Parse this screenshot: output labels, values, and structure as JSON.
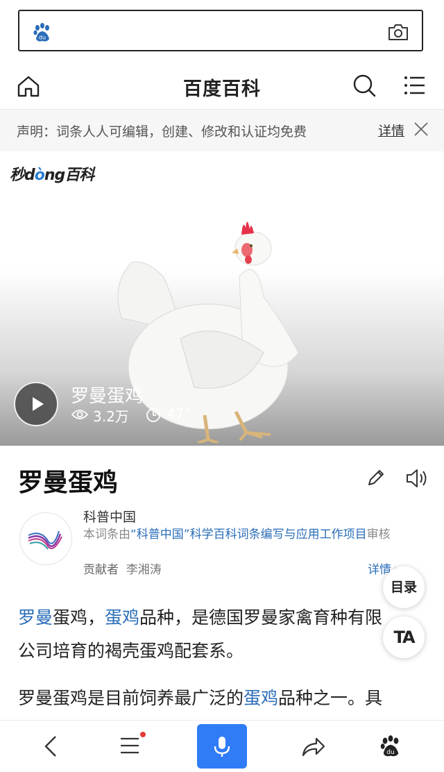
{
  "search": {
    "icon_left": "baidu-paw-icon",
    "icon_right": "camera-icon"
  },
  "header": {
    "title": "百度百科",
    "icons": [
      "home-icon",
      "search-icon",
      "menu-icon"
    ]
  },
  "notice": {
    "text": "声明：词条人人可编辑，创建、修改和认证均免费",
    "detail_label": "详情"
  },
  "video": {
    "logo_pre": "秒d",
    "logo_o": "ò",
    "logo_post": "ng百科",
    "title": "罗曼蛋鸡",
    "views": "3.2万",
    "duration": "47\""
  },
  "entry": {
    "title": "罗曼蛋鸡"
  },
  "certification": {
    "name": "科普中国",
    "desc_pre": "本词条由",
    "desc_link": "“科普中国”科学百科词条编写与应用工作项目",
    "desc_post": "审核",
    "contributor_label": "贡献者",
    "contributor_name": "李湘涛",
    "more_label": "详情 ▸"
  },
  "floating": {
    "toc_label": "目录",
    "text_size_label": "TA"
  },
  "content": {
    "p1_link1": "罗曼",
    "p1_t1": "蛋鸡，",
    "p1_link2": "蛋鸡",
    "p1_t2": "品种，是德国罗曼家禽育种有限",
    "p1_line2": "公司培育的褐壳蛋鸡配套系。",
    "p2_t1": "罗曼蛋鸡是目前饲养最广泛的",
    "p2_link": "蛋鸡",
    "p2_t2": "品种之一。具"
  },
  "colors": {
    "link": "#2a6db8",
    "mic": "#2f7cf6",
    "badge": "#e53935"
  }
}
